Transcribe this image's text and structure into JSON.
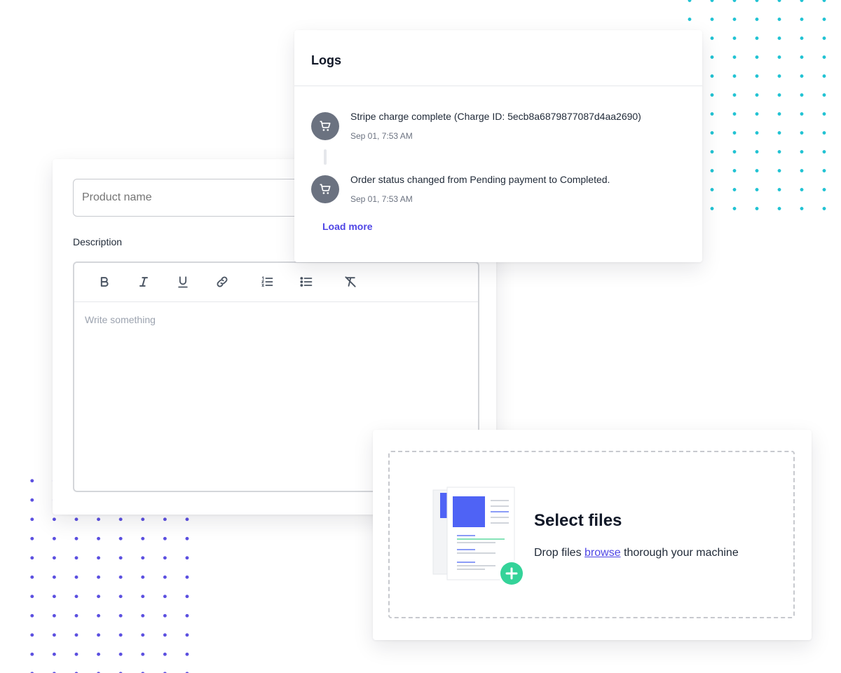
{
  "editor": {
    "product_placeholder": "Product name",
    "description_label": "Description",
    "body_placeholder": "Write something",
    "toolbar": [
      "bold-icon",
      "italic-icon",
      "underline-icon",
      "link-icon",
      "ordered-list-icon",
      "bullet-list-icon",
      "clear-format-icon"
    ]
  },
  "logs": {
    "title": "Logs",
    "entries": [
      {
        "text": "Stripe charge complete (Charge ID: 5ecb8a6879877087d4aa2690)",
        "time": "Sep 01, 7:53 AM",
        "icon": "cart-icon"
      },
      {
        "text": "Order status changed from Pending payment to Completed.",
        "time": "Sep 01, 7:53 AM",
        "icon": "cart-icon"
      }
    ],
    "load_more": "Load more"
  },
  "upload": {
    "title": "Select files",
    "text_before": "Drop files",
    "link": "browse",
    "text_after": "thorough your machine",
    "icon": "file-add-icon"
  },
  "colors": {
    "accent": "#4f46e5",
    "cyan_dots": "#22c3d3",
    "indigo_dots": "#5b4fe0",
    "success": "#34d399",
    "icon_gray": "#6b7280"
  }
}
